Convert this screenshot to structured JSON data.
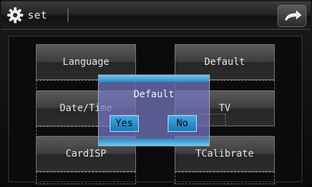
{
  "header": {
    "title": "set",
    "gear_icon": "gear-icon",
    "back_icon": "back-arrow-icon"
  },
  "menu": {
    "language": "Language",
    "default": "Default",
    "datetime": "Date/Time",
    "tv": "TV",
    "cardisp": "CardISP",
    "tcalibrate": "TCalibrate"
  },
  "dialog": {
    "title": "Default",
    "yes": "Yes",
    "no": "No"
  },
  "colors": {
    "accent": "#2a8cc4",
    "dialog_bg": "#7878c8"
  }
}
